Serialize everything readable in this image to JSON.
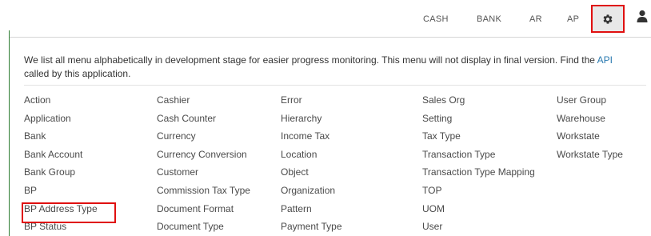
{
  "nav": {
    "links": [
      "CASH",
      "BANK",
      "AR",
      "AP"
    ],
    "settings_icon": "gear-icon",
    "user_icon": "user-icon",
    "highlight_color": "#e01010"
  },
  "intro": {
    "text_before": "We list all menu alphabetically in development stage for easier progress monitoring. This menu will not display in final version. Find the ",
    "link_text": "API",
    "text_after": " called by this application."
  },
  "menu": {
    "columns": [
      [
        "Action",
        "Application",
        "Bank",
        "Bank Account",
        "Bank Group",
        "BP",
        "BP Address Type",
        "BP Status"
      ],
      [
        "Cashier",
        "Cash Counter",
        "Currency",
        "Currency Conversion",
        "Customer",
        "Commission Tax Type",
        "Document Format",
        "Document Type"
      ],
      [
        "Error",
        "Hierarchy",
        "Income Tax",
        "Location",
        "Object",
        "Organization",
        "Pattern",
        "Payment Type"
      ],
      [
        "Sales Org",
        "Setting",
        "Tax Type",
        "Transaction Type",
        "Transaction Type Mapping",
        "TOP",
        "UOM",
        "User"
      ],
      [
        "User Group",
        "Warehouse",
        "Workstate",
        "Workstate Type"
      ]
    ]
  },
  "colors": {
    "link": "#2a7ab0",
    "text": "#4a4a4a",
    "accent_rule": "#2e7d32"
  }
}
